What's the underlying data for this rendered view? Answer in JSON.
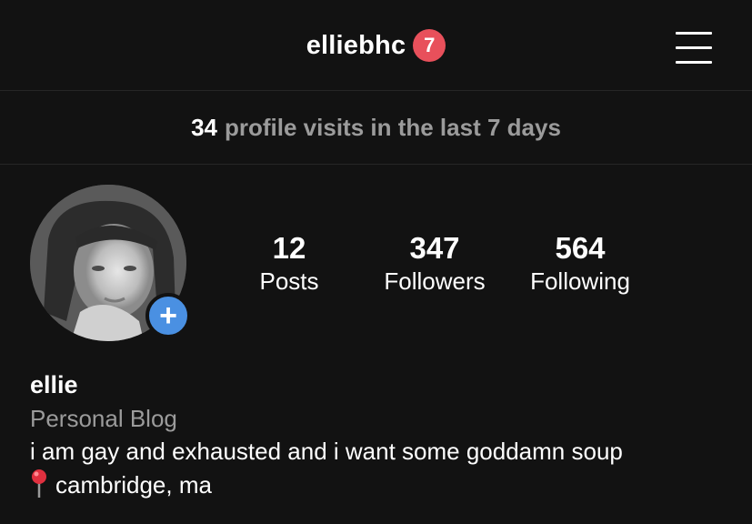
{
  "header": {
    "username": "elliebhc",
    "notification_count": "7"
  },
  "visits": {
    "count": "34",
    "label": "profile visits in the last 7 days"
  },
  "stats": [
    {
      "value": "12",
      "label": "Posts"
    },
    {
      "value": "347",
      "label": "Followers"
    },
    {
      "value": "564",
      "label": "Following"
    }
  ],
  "bio": {
    "name": "ellie",
    "category": "Personal Blog",
    "description": "i am gay and exhausted and i want some goddamn soup",
    "location": "cambridge, ma"
  },
  "colors": {
    "background": "#121212",
    "badge": "#e8505b",
    "add_button": "#4a90e2",
    "muted_text": "#9b9b9b"
  },
  "icons": {
    "menu": "hamburger-menu-icon",
    "add": "plus-icon",
    "location": "pin-icon"
  }
}
